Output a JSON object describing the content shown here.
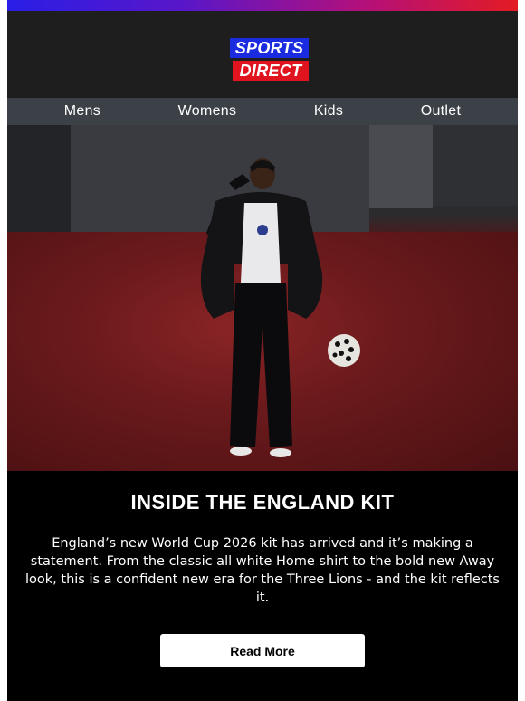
{
  "brand": {
    "logo_line1": "SPORTS",
    "logo_line2": "DIRECT",
    "colors": {
      "blue": "#1a2be0",
      "red": "#e0141e"
    }
  },
  "nav": {
    "items": [
      {
        "label": "Mens"
      },
      {
        "label": "Womens"
      },
      {
        "label": "Kids"
      },
      {
        "label": "Outlet"
      }
    ]
  },
  "hero": {
    "image": "england-kit-model-photo"
  },
  "article": {
    "title": "INSIDE THE ENGLAND KIT",
    "body": "England’s new World Cup 2026 kit has arrived and it’s making a statement. From the classic all white Home shirt to the bold new Away look, this is a confident new era for the Three Lions - and the kit reflects it.",
    "cta_label": "Read More"
  },
  "colors": {
    "gradient_start": "#2a1ee6",
    "gradient_end": "#e31b23",
    "header_bg": "#1e1e1e",
    "nav_bg": "#3c4147",
    "content_bg": "#000000"
  }
}
